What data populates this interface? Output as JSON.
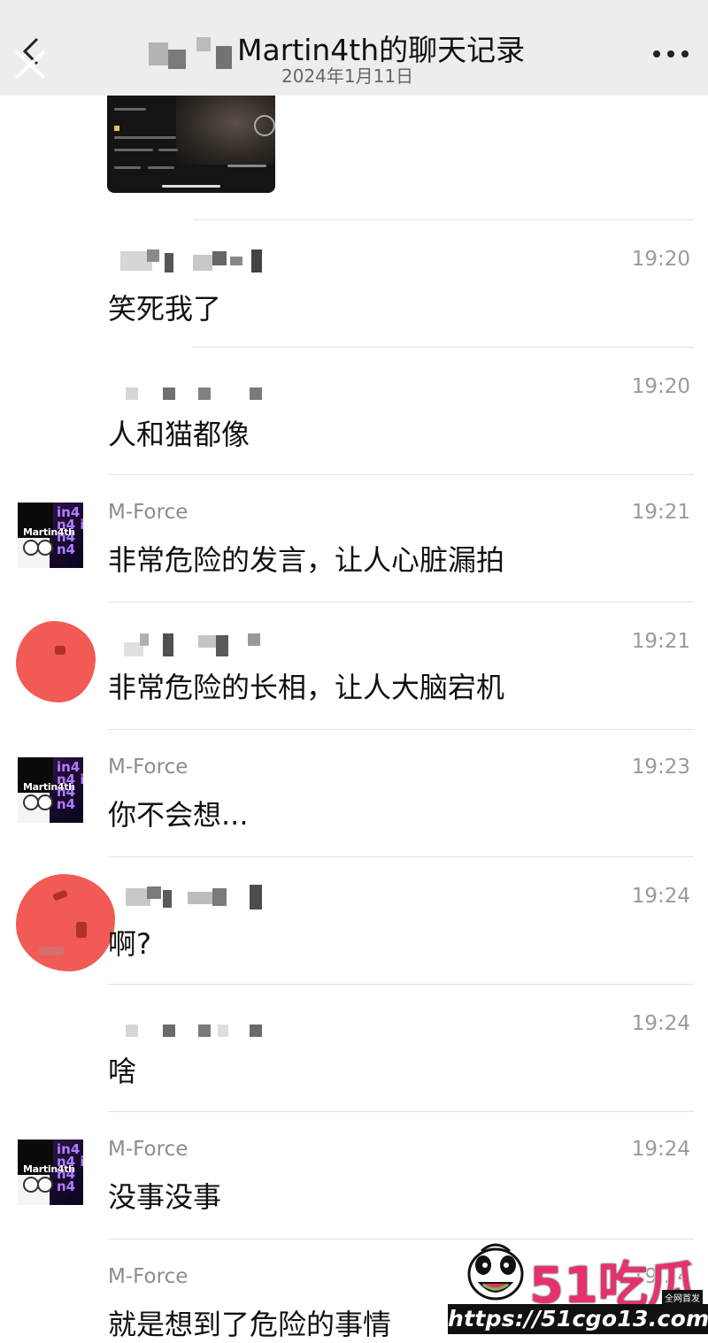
{
  "header": {
    "title": "Martin4th的聊天记录",
    "date": "2024年1月11日",
    "back_icon": "chevron-left-icon",
    "more_icon": "more-dots-icon",
    "background": "#ededed"
  },
  "messages": [
    {
      "sender": "",
      "time": "19:20",
      "text": "笑死我了"
    },
    {
      "sender": "",
      "time": "19:20",
      "text": "人和猫都像"
    },
    {
      "sender": "M-Force",
      "time": "19:21",
      "text": "非常危险的发言，让人心脏漏拍"
    },
    {
      "sender": "",
      "time": "19:21",
      "text": "非常危险的长相，让人大脑宕机"
    },
    {
      "sender": "M-Force",
      "time": "19:23",
      "text": "你不会想..."
    },
    {
      "sender": "",
      "time": "19:24",
      "text": "啊?"
    },
    {
      "sender": "",
      "time": "19:24",
      "text": "啥"
    },
    {
      "sender": "M-Force",
      "time": "19:24",
      "text": "没事没事"
    },
    {
      "sender": "M-Force",
      "time": "19:24",
      "text": "就是想到了危险的事情"
    }
  ],
  "avatar": {
    "brand_text": "Martin4th",
    "side_text": "in4 n4 in4 n4"
  },
  "watermark": {
    "logo": "51吃瓜",
    "badge": "全网首发",
    "url": "https://51cgo13.com"
  },
  "colors": {
    "redacted_avatar": "#f25a55",
    "watermark_pink": "#e8316b"
  }
}
